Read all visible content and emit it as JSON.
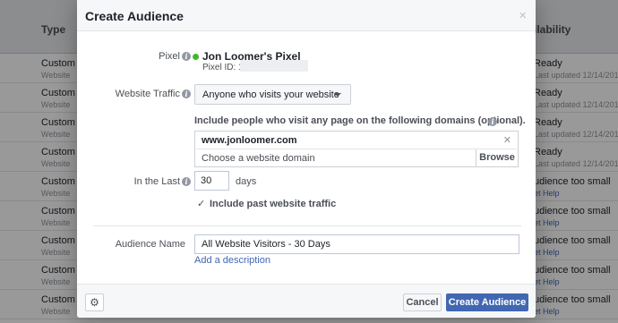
{
  "background": {
    "col_type": "Type",
    "col_availability": "ilability",
    "rows": [
      {
        "name": "Custom A",
        "sub": "Website",
        "status": "Ready",
        "status2": "Last updated 12/14/2015",
        "link": false
      },
      {
        "name": "Custom A",
        "sub": "Website",
        "status": "Ready",
        "status2": "Last updated 12/14/2015",
        "link": false
      },
      {
        "name": "Custom A",
        "sub": "Website",
        "status": "Ready",
        "status2": "Last updated 12/14/2015",
        "link": false
      },
      {
        "name": "Custom A",
        "sub": "Website",
        "status": "Ready",
        "status2": "Last updated 12/14/2015",
        "link": false
      },
      {
        "name": "Custom A",
        "sub": "Website",
        "status": "udience too small",
        "status2": "et Help",
        "link": true
      },
      {
        "name": "Custom A",
        "sub": "Website",
        "status": "udience too small",
        "status2": "et Help",
        "link": true
      },
      {
        "name": "Custom A",
        "sub": "Website",
        "status": "udience too small",
        "status2": "et Help",
        "link": true
      },
      {
        "name": "Custom A",
        "sub": "Website",
        "status": "udience too small",
        "status2": "et Help",
        "link": true
      },
      {
        "name": "Custom A",
        "sub": "Website",
        "status": "udience too small",
        "status2": "et Help",
        "link": true
      }
    ]
  },
  "dialog": {
    "title": "Create Audience",
    "close_glyph": "×",
    "pixel": {
      "label": "Pixel",
      "name": "Jon Loomer's Pixel",
      "id_label": "Pixel ID: 1",
      "status_color": "#42b72a"
    },
    "website_traffic": {
      "label": "Website Traffic",
      "selected": "Anyone who visits your website"
    },
    "domains": {
      "title": "Include people who visit any page on the following domains (optional).",
      "token": "www.jonloomer.com",
      "placeholder": "Choose a website domain",
      "browse": "Browse"
    },
    "in_the_last": {
      "label": "In the Last",
      "value": "30",
      "unit": "days"
    },
    "include_past": {
      "label": "Include past website traffic",
      "checked": true
    },
    "audience_name": {
      "label": "Audience Name",
      "value": "All Website Visitors - 30 Days",
      "add_description": "Add a description"
    },
    "footer": {
      "settings_icon": "gear-icon",
      "cancel": "Cancel",
      "create": "Create Audience"
    }
  },
  "colors": {
    "accent": "#4267b2",
    "overlay": "rgba(0,0,0,0.40)"
  }
}
